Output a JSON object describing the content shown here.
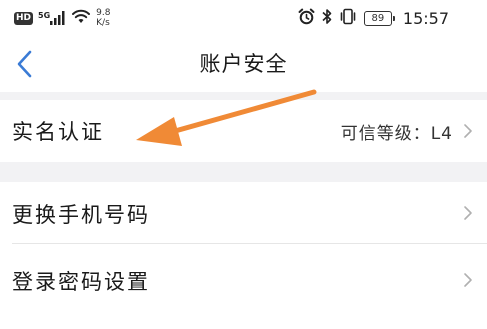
{
  "status_bar": {
    "hd_label": "HD",
    "network_label": "5G",
    "speed_value": "9.8",
    "speed_unit": "K/s",
    "battery_level": "89",
    "time": "15:57",
    "icons": [
      "hd-icon",
      "signal-icon",
      "wifi-icon",
      "alarm-icon",
      "bluetooth-icon",
      "vibrate-icon",
      "battery-icon"
    ]
  },
  "header": {
    "title": "账户安全",
    "back_icon": "chevron-left-icon",
    "accent_color": "#3a7bd5"
  },
  "rows": [
    {
      "label": "实名认证",
      "value": "可信等级：L4",
      "icon": "chevron-right-icon"
    },
    {
      "label": "更换手机号码",
      "icon": "chevron-right-icon"
    },
    {
      "label": "登录密码设置",
      "icon": "chevron-right-icon"
    }
  ],
  "annotation": {
    "icon": "arrow-annotation-icon",
    "color": "#f08a36"
  }
}
